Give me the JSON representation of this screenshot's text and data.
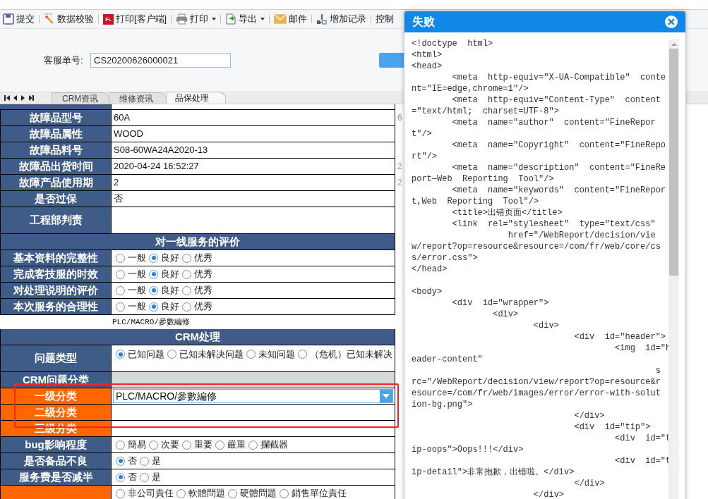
{
  "toolbar": {
    "items": [
      {
        "label": "提交",
        "dropdown": false
      },
      {
        "label": "数据校验",
        "dropdown": false
      },
      {
        "label": "打印[客户端]",
        "dropdown": false,
        "icon_text": "FL"
      },
      {
        "label": "打印",
        "dropdown": true
      },
      {
        "label": "导出",
        "dropdown": true
      },
      {
        "label": "邮件",
        "dropdown": false
      },
      {
        "label": "增加记录",
        "dropdown": false
      }
    ],
    "trailing": "控制"
  },
  "form": {
    "label": "客服单号:",
    "value": "CS20200626000021"
  },
  "tabs": [
    {
      "label": "CRM资讯",
      "selected": false
    },
    {
      "label": "维修资讯",
      "selected": false
    },
    {
      "label": "品保处理",
      "selected": true
    }
  ],
  "table": {
    "rows": [
      {
        "kind": "field",
        "label": "故障品型号",
        "color": "#3f5c88",
        "value": "60A",
        "side": "6"
      },
      {
        "kind": "field",
        "label": "故障品属性",
        "color": "#3f5c88",
        "value": "WOOD"
      },
      {
        "kind": "field",
        "label": "故障品料号",
        "color": "#3f5c88",
        "value": "S08-60WA24A2020-13"
      },
      {
        "kind": "field",
        "label": "故障品出货时间",
        "color": "#3f5c88",
        "value": "2020-04-24 16:52:27",
        "side": "2"
      },
      {
        "kind": "field",
        "label": "故障产品使用期",
        "color": "#3f5c88",
        "value": "2",
        "side": "2"
      },
      {
        "kind": "field",
        "label": "是否过保",
        "color": "#3f5c88",
        "value": "否"
      },
      {
        "kind": "blank",
        "label": "工程部判责",
        "color": "#3f5c88",
        "tall": true
      },
      {
        "kind": "section",
        "label": "对一线服务的评价"
      },
      {
        "kind": "radio",
        "label": "基本资料的完整性",
        "color": "#3f5c88",
        "options": [
          {
            "label": "一般",
            "selected": false
          },
          {
            "label": "良好",
            "selected": true
          },
          {
            "label": "优秀",
            "selected": false
          }
        ]
      },
      {
        "kind": "radio",
        "label": "完成客技服的时效",
        "color": "#3f5c88",
        "options": [
          {
            "label": "一般",
            "selected": false
          },
          {
            "label": "良好",
            "selected": true
          },
          {
            "label": "优秀",
            "selected": false
          }
        ]
      },
      {
        "kind": "radio",
        "label": "对处理说明的评价",
        "color": "#3f5c88",
        "options": [
          {
            "label": "一般",
            "selected": false
          },
          {
            "label": "良好",
            "selected": true
          },
          {
            "label": "优秀",
            "selected": false
          }
        ]
      },
      {
        "kind": "radio",
        "label": "本次服务的合理性",
        "color": "#3f5c88",
        "options": [
          {
            "label": "一般",
            "selected": false
          },
          {
            "label": "良好",
            "selected": true
          },
          {
            "label": "优秀",
            "selected": false
          }
        ]
      },
      {
        "kind": "note",
        "label": "PLC/MACRO/參數編修"
      },
      {
        "kind": "section",
        "label": "CRM处理"
      },
      {
        "kind": "radio",
        "label": "问题类型",
        "color": "#3f5c88",
        "tall": true,
        "options": [
          {
            "label": "已知问题",
            "selected": true
          },
          {
            "label": "已知未解决问题",
            "selected": false
          },
          {
            "label": "未知问题",
            "selected": false
          },
          {
            "label": "（危机）已知未解决",
            "selected": false
          }
        ]
      },
      {
        "kind": "blank",
        "label": "CRM问题分类",
        "color": "#3f5c88",
        "shaded": true
      },
      {
        "kind": "select",
        "label": "一级分类",
        "color": "#ff6600",
        "value": "PLC/MACRO/參數編修"
      },
      {
        "kind": "blank",
        "label": "二级分类",
        "color": "#ff6600"
      },
      {
        "kind": "blank",
        "label": "三级分类",
        "color": "#ff6600"
      },
      {
        "kind": "radio",
        "label": "bug影响程度",
        "color": "#3f5c88",
        "options": [
          {
            "label": "簡易",
            "selected": false
          },
          {
            "label": "次要",
            "selected": false
          },
          {
            "label": "重要",
            "selected": false
          },
          {
            "label": "嚴重",
            "selected": false
          },
          {
            "label": "攔截器",
            "selected": false
          }
        ]
      },
      {
        "kind": "radio",
        "label": "是否备品不良",
        "color": "#3f5c88",
        "options": [
          {
            "label": "否",
            "selected": true
          },
          {
            "label": "是",
            "selected": false
          }
        ]
      },
      {
        "kind": "radio",
        "label": "服务费是否减半",
        "color": "#3f5c88",
        "options": [
          {
            "label": "否",
            "selected": true
          },
          {
            "label": "是",
            "selected": false
          }
        ]
      },
      {
        "kind": "radio",
        "color": "#ff6600",
        "options": [
          {
            "label": "非公司責任",
            "selected": false
          },
          {
            "label": "軟體問題",
            "selected": false
          },
          {
            "label": "硬體問題",
            "selected": false
          },
          {
            "label": "銷售單位責任",
            "selected": false
          }
        ]
      }
    ]
  },
  "annotation": {
    "kind": "rectangle",
    "color": "#ff2020"
  },
  "dialog": {
    "title": "失败",
    "blocks": [
      [
        "<!doctype  html>",
        "<html>",
        "<head>",
        "        <meta  http-equiv=\"X-UA-Compatible\"  conte",
        "nt=\"IE=edge,chrome=1\"/>",
        "        <meta  http-equiv=\"Content-Type\"  content",
        "=\"text/html;  charset=UTF-8\">",
        "        <meta  name=\"author\"  content=\"FineRepor",
        "t\"/>",
        "        <meta  name=\"Copyright\"  content=\"FineRepo",
        "rt\"/>",
        "        <meta  name=\"description\"  content=\"FineRe",
        "port—Web  Reporting  Tool\"/>",
        "        <meta  name=\"keywords\"  content=\"FineRepor",
        "t,Web  Reporting  Tool\"/>",
        "        <title>出错页面</title>",
        "        <link  rel=\"stylesheet\"  type=\"text/css\"",
        "                   href=\"/WebReport/decision/vie",
        "w/report?op=resource&resource=/com/fr/web/core/cs",
        "s/error.css\">",
        "</head>"
      ],
      [
        "<body>",
        "        <div  id=\"wrapper\">",
        "                <div>",
        "                        <div>",
        "                                <div  id=\"header\">",
        "                                        <img  id=\"h",
        "eader-content\"",
        "                                                s",
        "rc=\"/WebReport/decision/view/report?op=resource&r",
        "esource=/com/fr/web/images/error/error-with-solut",
        "ion-bg.png\">",
        "                                </div>",
        "                                <div  id=\"tip\">",
        "                                        <div  id=\"t",
        "ip-oops\">Oops!!!</div>",
        "                                        <div  id=\"t",
        "ip-detail\">非常抱歉，出错啦。</div>",
        "                                </div>",
        "                        </div>"
      ]
    ]
  }
}
